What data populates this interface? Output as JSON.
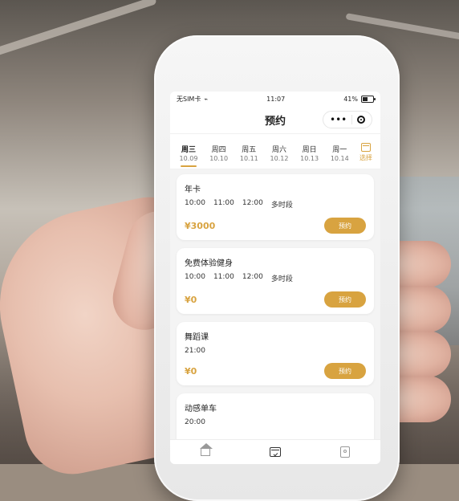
{
  "status_bar": {
    "carrier": "无SIM卡",
    "time": "11:07",
    "battery": "41%",
    "battery_level": 0.41
  },
  "nav": {
    "title": "预约"
  },
  "days": [
    {
      "weekday": "周三",
      "date": "10.09",
      "active": true
    },
    {
      "weekday": "周四",
      "date": "10.10",
      "active": false
    },
    {
      "weekday": "周五",
      "date": "10.11",
      "active": false
    },
    {
      "weekday": "周六",
      "date": "10.12",
      "active": false
    },
    {
      "weekday": "周日",
      "date": "10.13",
      "active": false
    },
    {
      "weekday": "周一",
      "date": "10.14",
      "active": false
    }
  ],
  "picker": {
    "label": "选择"
  },
  "cards": [
    {
      "name": "年卡",
      "times": [
        "10:00",
        "11:00",
        "12:00",
        "多时段"
      ],
      "price": "¥3000",
      "button": "预约"
    },
    {
      "name": "免费体验健身",
      "times": [
        "10:00",
        "11:00",
        "12:00",
        "多时段"
      ],
      "price": "¥0",
      "button": "预约"
    },
    {
      "name": "舞蹈课",
      "times": [
        "21:00"
      ],
      "price": "¥0",
      "button": "预约"
    },
    {
      "name": "动感单车",
      "times": [
        "20:00"
      ]
    }
  ],
  "colors": {
    "accent": "#d8a340",
    "text_primary": "#222222",
    "background": "#f4f4f4",
    "card": "#ffffff"
  },
  "icons": {
    "wifi": "wifi-icon",
    "battery": "battery-icon",
    "more": "more-icon",
    "close": "close-target-icon",
    "calendar": "calendar-icon",
    "home": "home-icon",
    "profile": "profile-icon"
  }
}
